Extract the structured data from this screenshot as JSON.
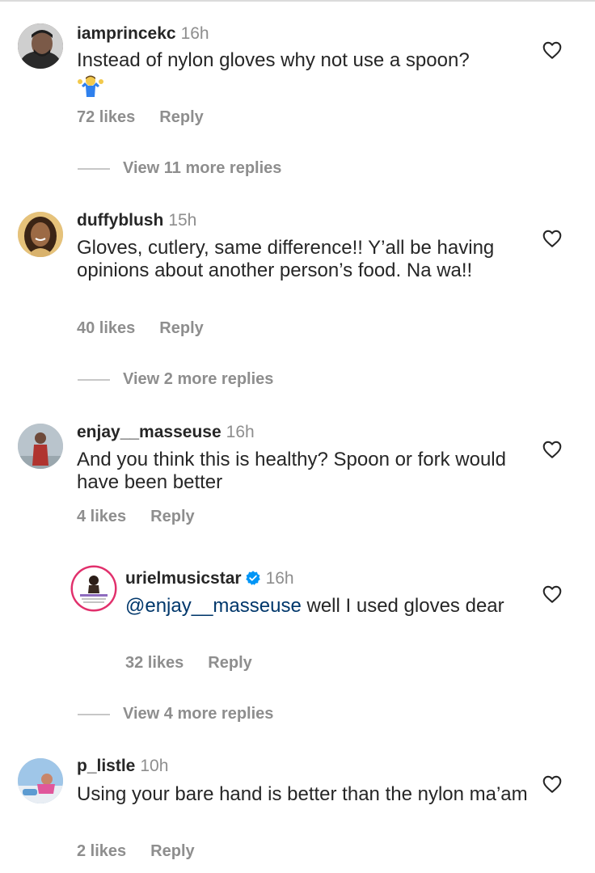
{
  "comments": [
    {
      "username": "iamprincekc",
      "time": "16h",
      "text": "Instead of nylon gloves why not use a spoon?",
      "emoji": "man-shrugging",
      "likes": "72 likes",
      "reply": "Reply",
      "view_more": "View 11 more replies"
    },
    {
      "username": "duffyblush",
      "time": "15h",
      "text": "Gloves, cutlery, same difference!! Y’all be having opinions about another person’s food. Na wa!!",
      "likes": "40 likes",
      "reply": "Reply",
      "view_more": "View 2 more replies"
    },
    {
      "username": "enjay__masseuse",
      "time": "16h",
      "text": "And you think this is healthy? Spoon or fork would have been better",
      "likes": "4 likes",
      "reply": "Reply",
      "replies": [
        {
          "username": "urielmusicstar",
          "verified": true,
          "time": "16h",
          "mention": "@enjay__masseuse",
          "text": " well I used gloves dear",
          "likes": "32 likes",
          "reply": "Reply"
        }
      ],
      "view_more": "View 4 more replies"
    },
    {
      "username": "p_listle",
      "time": "10h",
      "text": "Using your bare hand is better than the nylon ma’am",
      "likes": "2 likes",
      "reply": "Reply"
    }
  ],
  "icons": {
    "like": "heart-outline-icon",
    "verified": "verified-badge-icon"
  },
  "colors": {
    "username": "#262626",
    "secondary": "#8e8e8e",
    "mention": "#00376b",
    "verified": "#0095f6"
  }
}
